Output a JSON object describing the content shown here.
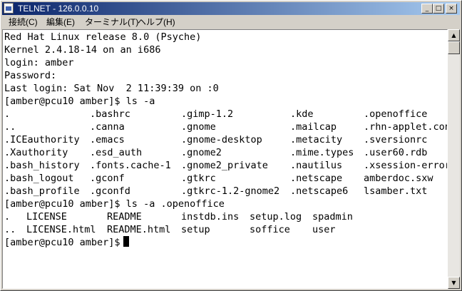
{
  "window": {
    "title": "TELNET - 126.0.0.10"
  },
  "title_buttons": {
    "minimize": "_",
    "maximize": "□",
    "close": "×"
  },
  "menu": [
    {
      "label": "接続(C)"
    },
    {
      "label": "編集(E)"
    },
    {
      "label": "ターミナル(T)"
    },
    {
      "label": "ヘルプ(H)"
    }
  ],
  "terminal": {
    "lines": [
      "Red Hat Linux release 8.0 (Psyche)",
      "Kernel 2.4.18-14 on an i686",
      "login: amber",
      "Password:",
      "Last login: Sat Nov  2 11:39:39 on :0",
      "[amber@pcu10 amber]$ ls -a"
    ],
    "listing1": [
      [
        ".",
        ".bashrc",
        ".gimp-1.2",
        ".kde",
        ".openoffice"
      ],
      [
        "..",
        ".canna",
        ".gnome",
        ".mailcap",
        ".rhn-applet.con"
      ],
      [
        ".ICEauthority",
        ".emacs",
        ".gnome-desktop",
        ".metacity",
        ".sversionrc"
      ],
      [
        ".Xauthority",
        ".esd_auth",
        ".gnome2",
        ".mime.types",
        ".user60.rdb"
      ],
      [
        ".bash_history",
        ".fonts.cache-1",
        ".gnome2_private",
        ".nautilus",
        ".xsession-error"
      ],
      [
        ".bash_logout",
        ".gconf",
        ".gtkrc",
        ".netscape",
        "amberdoc.sxw"
      ],
      [
        ".bash_profile",
        ".gconfd",
        ".gtkrc-1.2-gnome2",
        ".netscape6",
        "lsamber.txt"
      ]
    ],
    "command2": "[amber@pcu10 amber]$ ls -a .openoffice",
    "listing2": [
      [
        ".",
        "LICENSE",
        "README",
        "instdb.ins",
        "setup.log",
        "spadmin"
      ],
      [
        "..",
        "LICENSE.html",
        "README.html",
        "setup",
        "soffice",
        "user"
      ]
    ],
    "prompt": "[amber@pcu10 amber]$"
  },
  "scrollbar": {
    "up_arrow": "▲",
    "down_arrow": "▼"
  }
}
